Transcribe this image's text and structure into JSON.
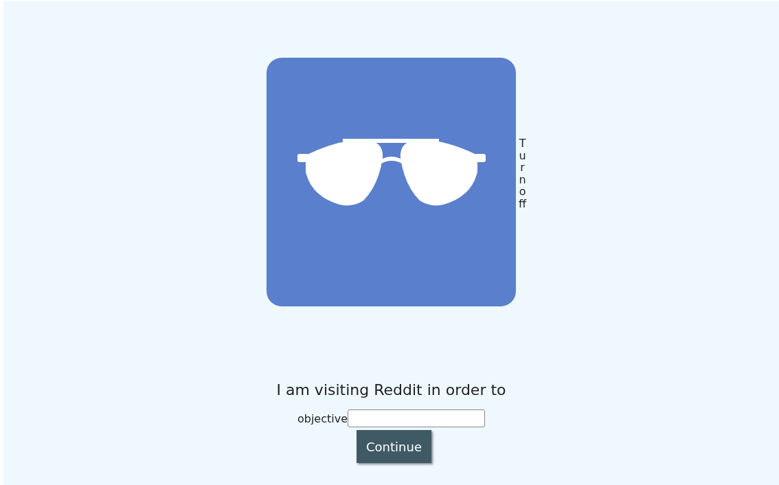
{
  "toggle": {
    "label": "Turnoff"
  },
  "prompt": "I am visiting Reddit in order to",
  "objective": {
    "label": "objective"
  },
  "continue_button": {
    "label": "Continue"
  }
}
